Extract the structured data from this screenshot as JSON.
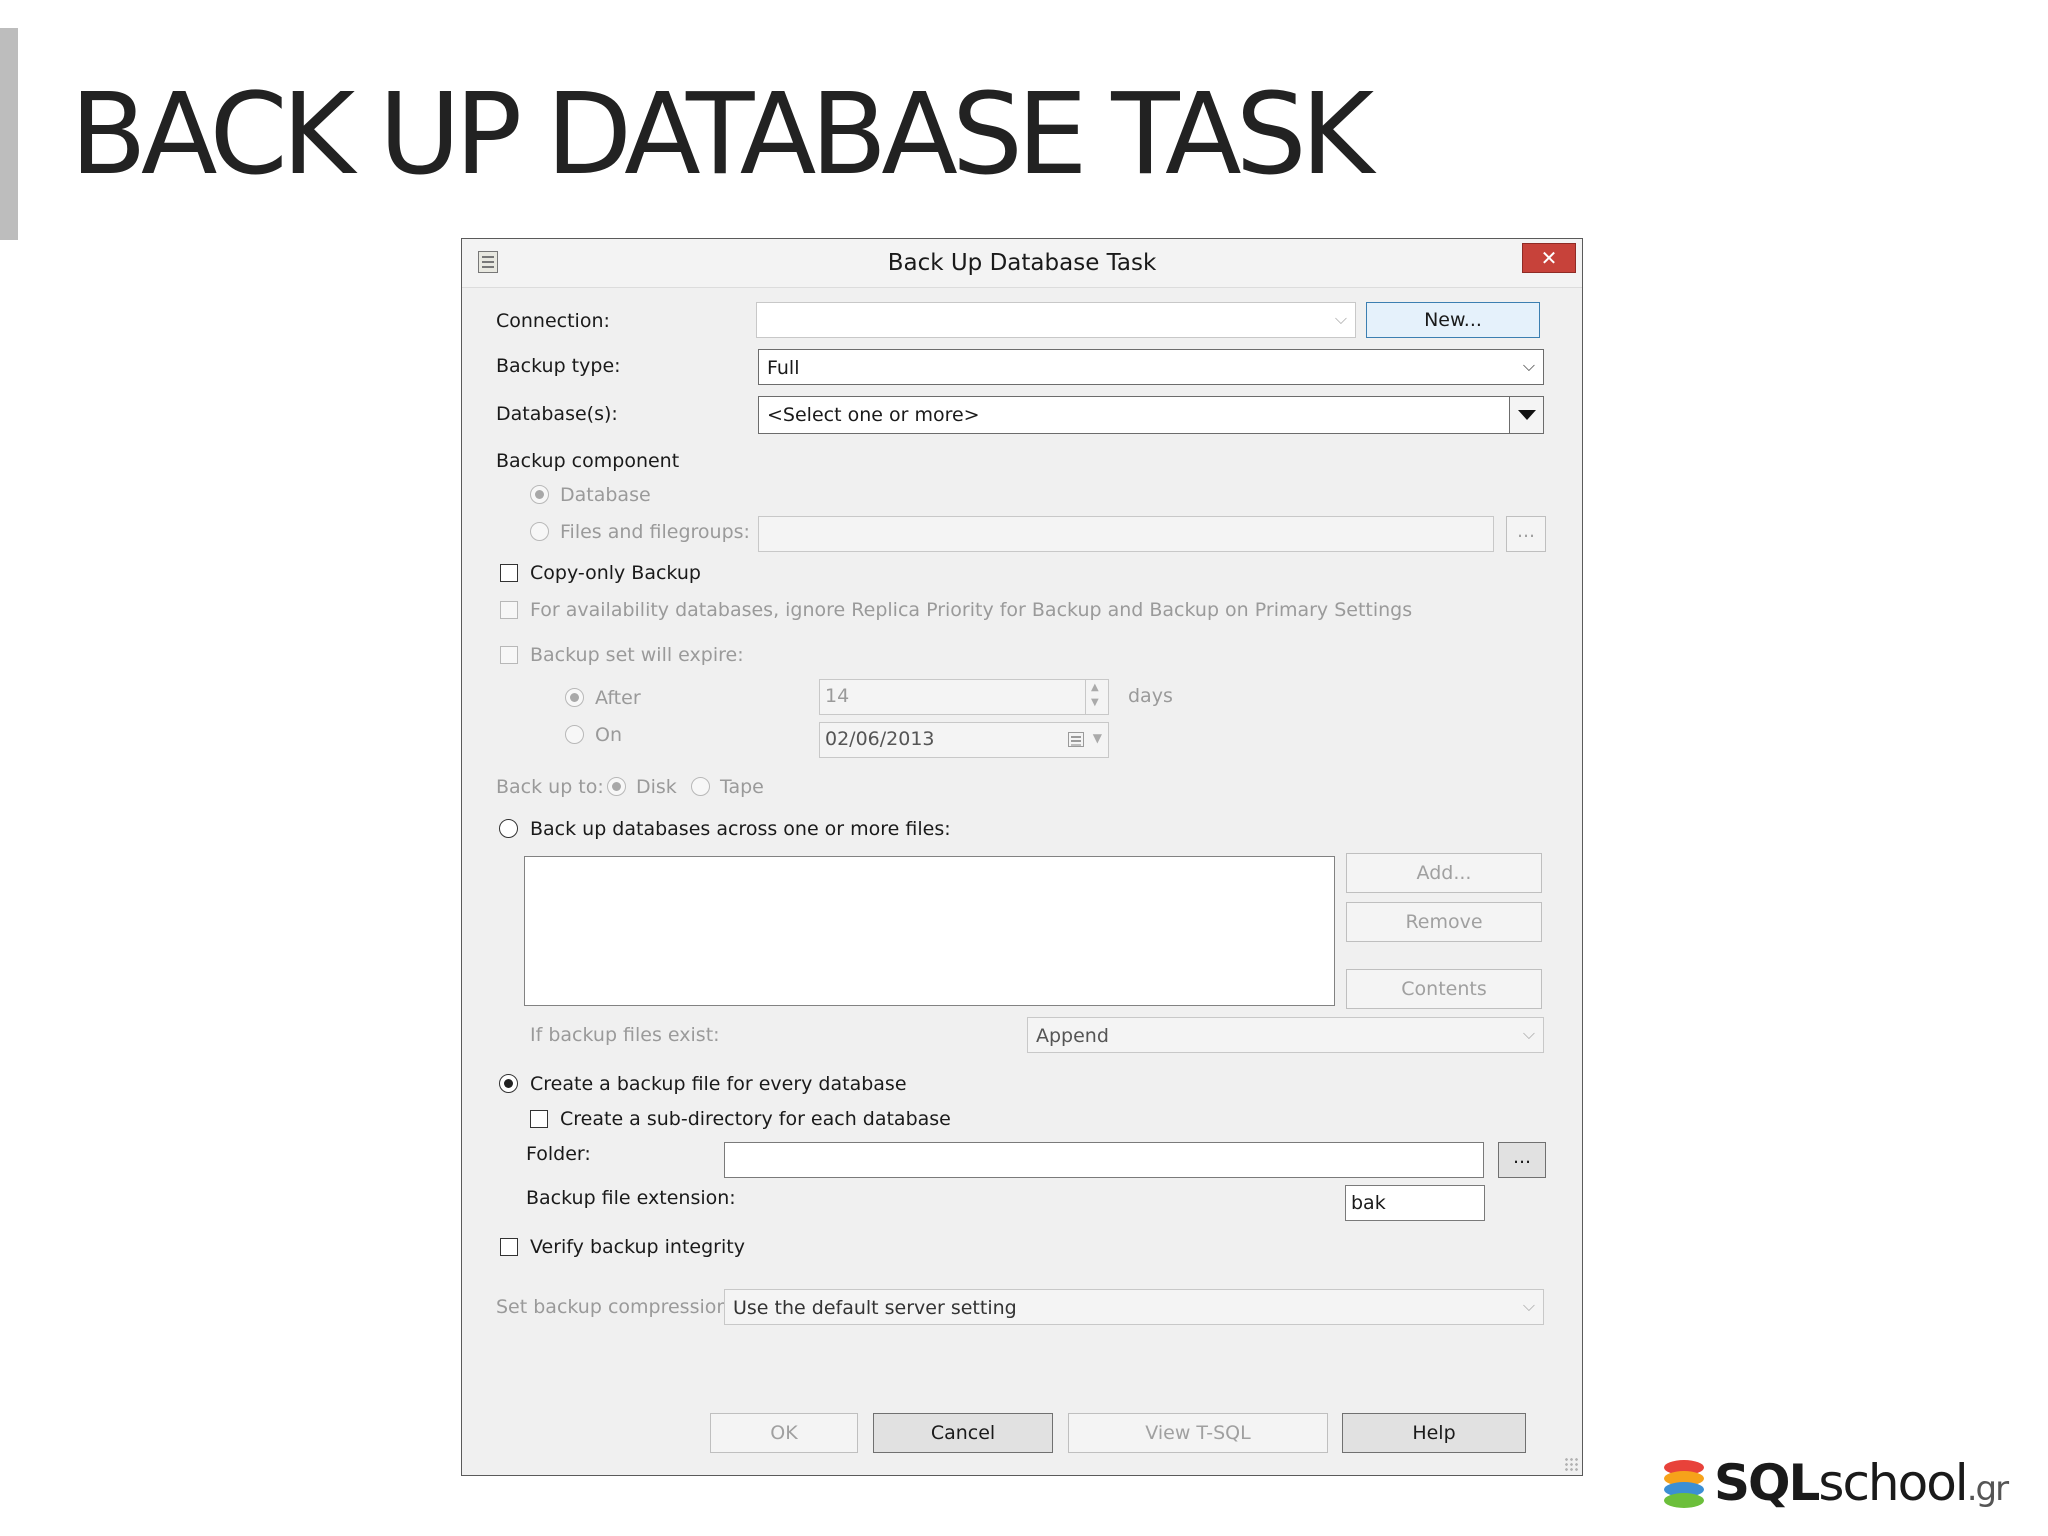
{
  "slide": {
    "title": "BACK UP DATABASE TASK"
  },
  "dialog": {
    "title": "Back Up Database Task",
    "close_label": "✕",
    "connection": {
      "label": "Connection:",
      "value": "",
      "new_label": "New..."
    },
    "backup_type": {
      "label": "Backup type:",
      "value": "Full"
    },
    "databases": {
      "label": "Database(s):",
      "value": "<Select one or more>"
    },
    "backup_component": {
      "label": "Backup component",
      "database_label": "Database",
      "files_label": "Files and filegroups:",
      "browse_label": "..."
    },
    "copy_only_label": "Copy-only Backup",
    "availability_label": "For availability databases, ignore Replica Priority for Backup and Backup on Primary Settings",
    "expire": {
      "label": "Backup set will expire:",
      "after_label": "After",
      "after_value": "14",
      "days_label": "days",
      "on_label": "On",
      "on_value": "02/06/2013"
    },
    "backup_to": {
      "label": "Back up to:",
      "disk_label": "Disk",
      "tape_label": "Tape"
    },
    "across_files_label": "Back up databases across one or more files:",
    "file_buttons": {
      "add": "Add...",
      "remove": "Remove",
      "contents": "Contents"
    },
    "if_exist": {
      "label": "If backup files exist:",
      "value": "Append"
    },
    "every_db_label": "Create a backup file for every database",
    "subdir_label": "Create a sub-directory for each database",
    "folder": {
      "label": "Folder:",
      "value": "",
      "browse_label": "..."
    },
    "extension": {
      "label": "Backup file extension:",
      "value": "bak"
    },
    "verify_label": "Verify backup integrity",
    "compression": {
      "label": "Set backup compression:",
      "value": "Use the default server setting"
    },
    "buttons": {
      "ok": "OK",
      "cancel": "Cancel",
      "view_tsql": "View T-SQL",
      "help": "Help"
    }
  },
  "logo": {
    "bold": "SQL",
    "light": "school",
    "suffix": ".gr"
  },
  "colors": {
    "close_button": "#c7423a",
    "logo_stack": [
      "#e8423a",
      "#f6a21a",
      "#3b8fd4",
      "#6cbf3b"
    ]
  }
}
